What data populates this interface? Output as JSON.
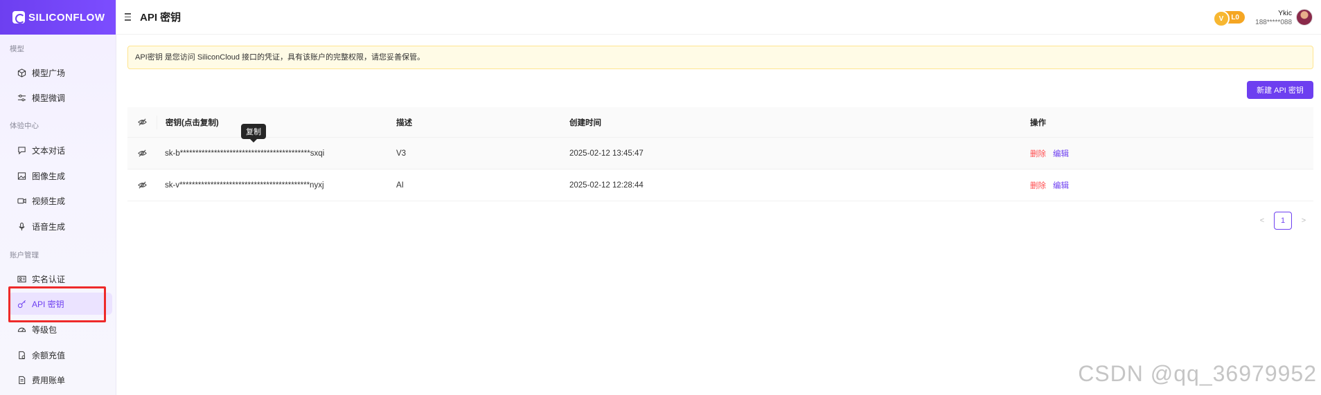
{
  "brand": {
    "name": "SILICONFLOW"
  },
  "sidebar": {
    "sections": [
      {
        "label": "模型"
      },
      {
        "label": "体验中心"
      },
      {
        "label": "账户管理"
      }
    ],
    "items": [
      {
        "label": "模型广场",
        "icon": "cube-icon"
      },
      {
        "label": "模型微调",
        "icon": "sliders-icon"
      },
      {
        "label": "文本对话",
        "icon": "chat-icon"
      },
      {
        "label": "图像生成",
        "icon": "image-icon"
      },
      {
        "label": "视频生成",
        "icon": "video-icon"
      },
      {
        "label": "语音生成",
        "icon": "mic-icon"
      },
      {
        "label": "实名认证",
        "icon": "id-card-icon"
      },
      {
        "label": "API 密钥",
        "icon": "key-icon",
        "active": true
      },
      {
        "label": "等级包",
        "icon": "gauge-icon"
      },
      {
        "label": "余额充值",
        "icon": "wallet-icon"
      },
      {
        "label": "费用账单",
        "icon": "bill-icon"
      }
    ]
  },
  "header": {
    "title": "API 密钥",
    "level": "L0",
    "user_name": "Ykic",
    "user_phone": "188*****088"
  },
  "notice": {
    "text": "API密钥 是您访问 SiliconCloud 接口的凭证，具有该账户的完整权限，请您妥善保管。"
  },
  "actions": {
    "new_key_label": "新建 API 密钥"
  },
  "table": {
    "columns": {
      "key": "密钥(点击复制)",
      "desc": "描述",
      "time": "创建时间",
      "ops": "操作"
    },
    "rows": [
      {
        "key": "sk-b******************************************sxqi",
        "desc": "V3",
        "time": "2025-02-12 13:45:47",
        "delete": "删除",
        "edit": "编辑"
      },
      {
        "key": "sk-v******************************************nyxj",
        "desc": "AI",
        "time": "2025-02-12 12:28:44",
        "delete": "删除",
        "edit": "编辑"
      }
    ]
  },
  "tooltip": {
    "text": "复制"
  },
  "pagination": {
    "current": "1",
    "prev": "<",
    "next": ">"
  },
  "watermark": "CSDN @qq_36979952",
  "colors": {
    "accent": "#6d3ff0",
    "danger": "#ff4d4f",
    "highlight": "#ee2a2a",
    "notice_bg": "#fffbe6"
  }
}
